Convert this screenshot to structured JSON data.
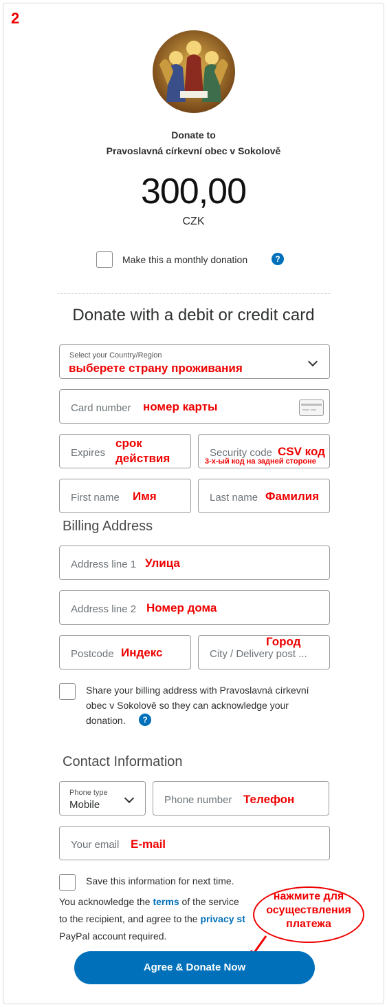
{
  "step_number": "2",
  "header": {
    "donate_to_label": "Donate to",
    "recipient": "Pravoslavná církevní obec v Sokolově",
    "amount": "300,00",
    "currency": "CZK",
    "monthly_label": "Make this a monthly donation"
  },
  "card_section": {
    "title": "Donate with a debit or credit card",
    "country_label": "Select your Country/Region",
    "country_annotation": "выберете страну проживания",
    "card_number_placeholder": "Card number",
    "card_number_annotation": "номер карты",
    "expires_placeholder": "Expires",
    "expires_annotation_1": "срок",
    "expires_annotation_2": "действия",
    "security_placeholder": "Security code",
    "security_annotation": "CSV код",
    "security_annotation_small": "3-х-ый код на задней стороне",
    "first_name_placeholder": "First name",
    "first_name_annotation": "Имя",
    "last_name_placeholder": "Last name",
    "last_name_annotation": "Фамилия"
  },
  "billing": {
    "title": "Billing Address",
    "address1_placeholder": "Address line 1",
    "address1_annotation": "Улица",
    "address2_placeholder": "Address line 2",
    "address2_annotation": "Номер дома",
    "postcode_placeholder": "Postcode",
    "postcode_annotation": "Индекс",
    "city_placeholder": "City / Delivery post ...",
    "city_annotation": "Город",
    "share_line1": "Share your billing address with Pravoslavná církevní",
    "share_line2": "obec v Sokolově so they can acknowledge your",
    "share_line3": "donation."
  },
  "contact": {
    "title": "Contact Information",
    "phone_type_label": "Phone type",
    "phone_type_value": "Mobile",
    "phone_placeholder": "Phone number",
    "phone_annotation": "Телефон",
    "email_placeholder": "Your email",
    "email_annotation": "E-mail",
    "save_label": "Save this information for next time."
  },
  "legal": {
    "line1_prefix": "You acknowledge the ",
    "terms_link": "terms",
    "line1_suffix": " of the service",
    "line2_prefix": "to the recipient, and agree to the ",
    "privacy_link": "privacy st",
    "line3": "PayPal account required."
  },
  "cta_label": "Agree & Donate Now",
  "callout": {
    "line1": "нажмите для",
    "line2": "осуществления",
    "line3": "платежа"
  },
  "icons": {
    "help": "question-circle-icon",
    "chevron": "chevron-down-icon",
    "card": "credit-card-icon",
    "arrow": "arrow-icon"
  },
  "colors": {
    "brand_blue": "#0070ba",
    "annotation_red": "#e00000"
  }
}
